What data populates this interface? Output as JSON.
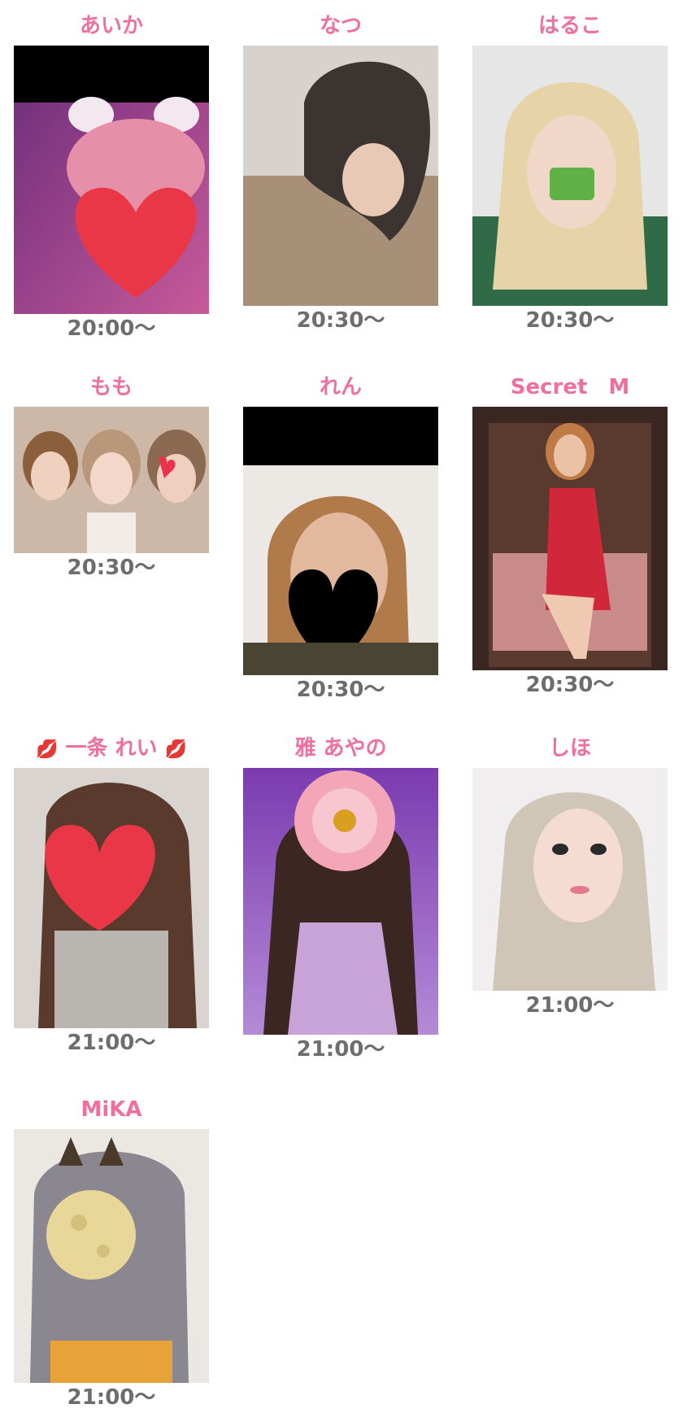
{
  "cast": [
    {
      "name": "あいか",
      "time": "20:00〜"
    },
    {
      "name": "なつ",
      "time": "20:30〜"
    },
    {
      "name": "はるこ",
      "time": "20:30〜"
    },
    {
      "name": "もも",
      "time": "20:30〜"
    },
    {
      "name": "れん",
      "time": "20:30〜"
    },
    {
      "name": "Secret　M",
      "time": "20:30〜"
    },
    {
      "name": "一条 れい",
      "name_decoration": "💋",
      "time": "21:00〜"
    },
    {
      "name": "雅 あやの",
      "time": "21:00〜"
    },
    {
      "name": "しほ",
      "time": "21:00〜"
    },
    {
      "name": "MiKA",
      "time": "21:00〜"
    }
  ]
}
